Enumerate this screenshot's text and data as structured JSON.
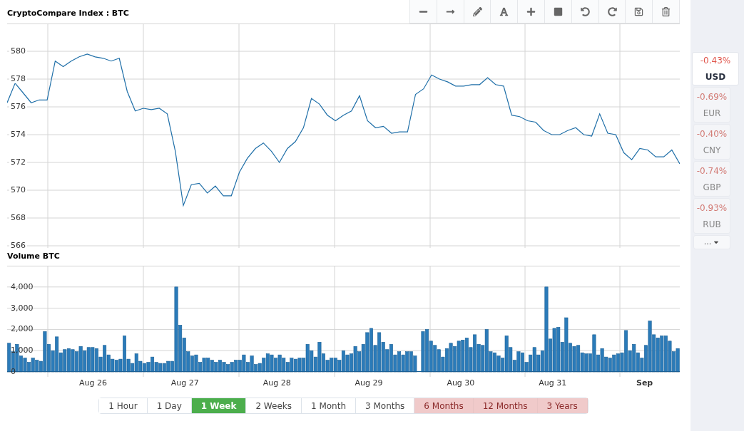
{
  "price_chart": {
    "chart_data": {
      "type": "line",
      "title": "CryptoCompare Index : BTC",
      "ylim": [
        566,
        582
      ],
      "yticks": [
        566,
        568,
        570,
        572,
        574,
        576,
        578,
        580
      ],
      "grid": true,
      "categories": [
        null,
        null,
        null,
        null,
        null,
        null,
        null,
        null,
        null,
        null,
        null,
        null,
        null,
        null,
        null,
        null,
        null,
        null,
        null,
        null,
        null,
        null,
        null,
        null,
        null,
        null,
        null,
        null,
        null,
        null,
        null,
        null,
        null,
        null,
        null,
        null,
        null,
        null,
        null,
        null,
        null,
        null,
        null,
        null,
        null,
        null,
        null,
        null,
        null,
        null,
        null,
        null,
        null,
        null,
        null,
        null,
        null,
        null,
        null,
        null,
        null,
        null,
        null,
        null,
        null,
        null,
        null,
        null,
        null,
        null,
        null,
        null,
        null,
        null,
        null,
        null,
        null,
        null,
        null,
        null,
        null,
        null,
        null,
        null,
        null
      ],
      "values": [
        576.3,
        577.7,
        577.0,
        576.3,
        576.5,
        576.5,
        579.3,
        578.9,
        579.3,
        579.6,
        579.8,
        579.6,
        579.5,
        579.3,
        579.5,
        577.1,
        575.7,
        575.9,
        575.8,
        575.9,
        575.5,
        572.8,
        568.9,
        570.4,
        570.5,
        569.8,
        570.3,
        569.6,
        569.6,
        571.3,
        572.3,
        573.0,
        573.4,
        572.8,
        572.0,
        573.0,
        573.5,
        574.5,
        576.6,
        576.2,
        575.4,
        575.0,
        575.4,
        575.7,
        576.8,
        575.0,
        574.5,
        574.6,
        574.1,
        574.2,
        574.2,
        576.9,
        577.3,
        578.3,
        578.0,
        577.8,
        577.5,
        577.5,
        577.6,
        577.6,
        578.1,
        577.6,
        577.5,
        575.4,
        575.3,
        575.0,
        574.9,
        574.3,
        574.0,
        574.0,
        574.3,
        574.5,
        574.0,
        573.9,
        575.5,
        574.1,
        574.0,
        572.7,
        572.2,
        573.0,
        572.9,
        572.4,
        572.4,
        572.9,
        571.9
      ]
    }
  },
  "volume_chart": {
    "chart_data": {
      "type": "bar",
      "title": "Volume BTC",
      "ylim": [
        0,
        5000
      ],
      "grid": true,
      "yticks": [
        {
          "value": 0,
          "label": "0"
        },
        {
          "value": 1000,
          "label": "1,000"
        },
        {
          "value": 2000,
          "label": "2,000"
        },
        {
          "value": 3000,
          "label": "3,000"
        },
        {
          "value": 4000,
          "label": "4,000"
        }
      ],
      "values": [
        1350,
        950,
        1300,
        750,
        650,
        450,
        650,
        550,
        500,
        1900,
        1300,
        1000,
        1650,
        900,
        1050,
        1100,
        1050,
        950,
        1200,
        1000,
        1150,
        1150,
        1100,
        700,
        1250,
        800,
        600,
        550,
        600,
        1700,
        600,
        400,
        850,
        500,
        400,
        450,
        700,
        450,
        400,
        400,
        500,
        500,
        4000,
        2200,
        1600,
        950,
        750,
        800,
        450,
        650,
        650,
        550,
        450,
        550,
        450,
        350,
        450,
        550,
        550,
        800,
        450,
        750,
        350,
        400,
        650,
        850,
        800,
        650,
        800,
        650,
        450,
        650,
        600,
        650,
        650,
        1300,
        1000,
        700,
        1400,
        850,
        550,
        650,
        650,
        550,
        1000,
        800,
        850,
        1200,
        950,
        1300,
        1850,
        2050,
        1250,
        1850,
        1400,
        1050,
        1300,
        800,
        950,
        800,
        950,
        950,
        750,
        0,
        1900,
        2000,
        1450,
        1250,
        1050,
        700,
        1100,
        1350,
        1200,
        1450,
        1500,
        1600,
        1150,
        1750,
        1300,
        1250,
        2000,
        950,
        900,
        750,
        650,
        1700,
        1150,
        550,
        950,
        900,
        450,
        800,
        1150,
        800,
        1000,
        4000,
        1550,
        2050,
        2100,
        1400,
        2550,
        1350,
        1200,
        1250,
        900,
        850,
        850,
        1750,
        800,
        1100,
        700,
        650,
        800,
        850,
        900,
        1950,
        1000,
        1300,
        900,
        650,
        1250,
        2400,
        1750,
        1600,
        1700,
        1700,
        1450,
        950,
        1100
      ]
    },
    "date_labels": [
      {
        "label": "Aug 26",
        "bold": false
      },
      {
        "label": "Aug 27",
        "bold": false
      },
      {
        "label": "Aug 28",
        "bold": false
      },
      {
        "label": "Aug 29",
        "bold": false
      },
      {
        "label": "Aug 30",
        "bold": false
      },
      {
        "label": "Aug 31",
        "bold": false
      },
      {
        "label": "Sep",
        "bold": true
      }
    ]
  },
  "toolbar": [
    {
      "kind": "line"
    },
    {
      "kind": "arrow"
    },
    {
      "kind": "pencil"
    },
    {
      "kind": "text"
    },
    {
      "kind": "plus"
    },
    {
      "kind": "rect"
    },
    {
      "kind": "undo"
    },
    {
      "kind": "redo"
    },
    {
      "kind": "save"
    },
    {
      "kind": "delete"
    }
  ],
  "currencies": [
    {
      "change": "-0.43%",
      "code": "USD",
      "selected": true
    },
    {
      "change": "-0.69%",
      "code": "EUR",
      "selected": false
    },
    {
      "change": "-0.40%",
      "code": "CNY",
      "selected": false
    },
    {
      "change": "-0.74%",
      "code": "GBP",
      "selected": false
    },
    {
      "change": "-0.93%",
      "code": "RUB",
      "selected": false
    }
  ],
  "more_button": {
    "label": "..."
  },
  "ranges": [
    {
      "label": "1 Hour",
      "selected": false,
      "disabled": false
    },
    {
      "label": "1 Day",
      "selected": false,
      "disabled": false
    },
    {
      "label": "1 Week",
      "selected": true,
      "disabled": false
    },
    {
      "label": "2 Weeks",
      "selected": false,
      "disabled": false
    },
    {
      "label": "1 Month",
      "selected": false,
      "disabled": false
    },
    {
      "label": "3 Months",
      "selected": false,
      "disabled": false
    },
    {
      "label": "6 Months",
      "selected": false,
      "disabled": true
    },
    {
      "label": "12 Months",
      "selected": false,
      "disabled": true
    },
    {
      "label": "3 Years",
      "selected": false,
      "disabled": true
    }
  ]
}
